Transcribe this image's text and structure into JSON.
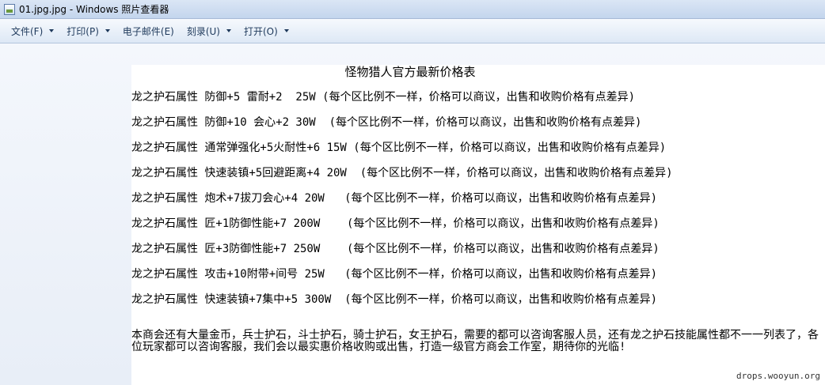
{
  "window": {
    "title": "01.jpg.jpg - Windows 照片查看器"
  },
  "menu": {
    "items": [
      {
        "label": "文件(F)"
      },
      {
        "label": "打印(P)"
      },
      {
        "label": "电子邮件(E)"
      },
      {
        "label": "刻录(U)"
      },
      {
        "label": "打开(O)"
      }
    ]
  },
  "image": {
    "title": "怪物猎人官方最新价格表",
    "lines": [
      "龙之护石属性 防御+5 雷耐+2  25W (每个区比例不一样，价格可以商议，出售和收购价格有点差异)",
      "龙之护石属性 防御+10 会心+2 30W  (每个区比例不一样，价格可以商议，出售和收购价格有点差异)",
      "龙之护石属性 通常弹强化+5火耐性+6 15W (每个区比例不一样，价格可以商议，出售和收购价格有点差异)",
      "龙之护石属性 快速装镇+5回避距离+4 20W  (每个区比例不一样，价格可以商议，出售和收购价格有点差异)",
      "龙之护石属性 炮术+7拔刀会心+4 20W   (每个区比例不一样，价格可以商议，出售和收购价格有点差异)",
      "龙之护石属性 匠+1防御性能+7 200W    (每个区比例不一样，价格可以商议，出售和收购价格有点差异)",
      "龙之护石属性 匠+3防御性能+7 250W    (每个区比例不一样，价格可以商议，出售和收购价格有点差异)",
      "龙之护石属性 攻击+10附带+间号 25W   (每个区比例不一样，价格可以商议，出售和收购价格有点差异)",
      "龙之护石属性 快速装镇+7集中+5 300W  (每个区比例不一样，价格可以商议，出售和收购价格有点差异)"
    ],
    "footer": "本商会还有大量金币，兵士护石，斗士护石，骑士护石，女王护石，需要的都可以咨询客服人员，还有龙之护石技能属性都不一一列表了，各位玩家都可以咨询客服，我们会以最实惠价格收购或出售，打造一级官方商会工作室，期待你的光临!",
    "watermark": "drops.wooyun.org"
  }
}
